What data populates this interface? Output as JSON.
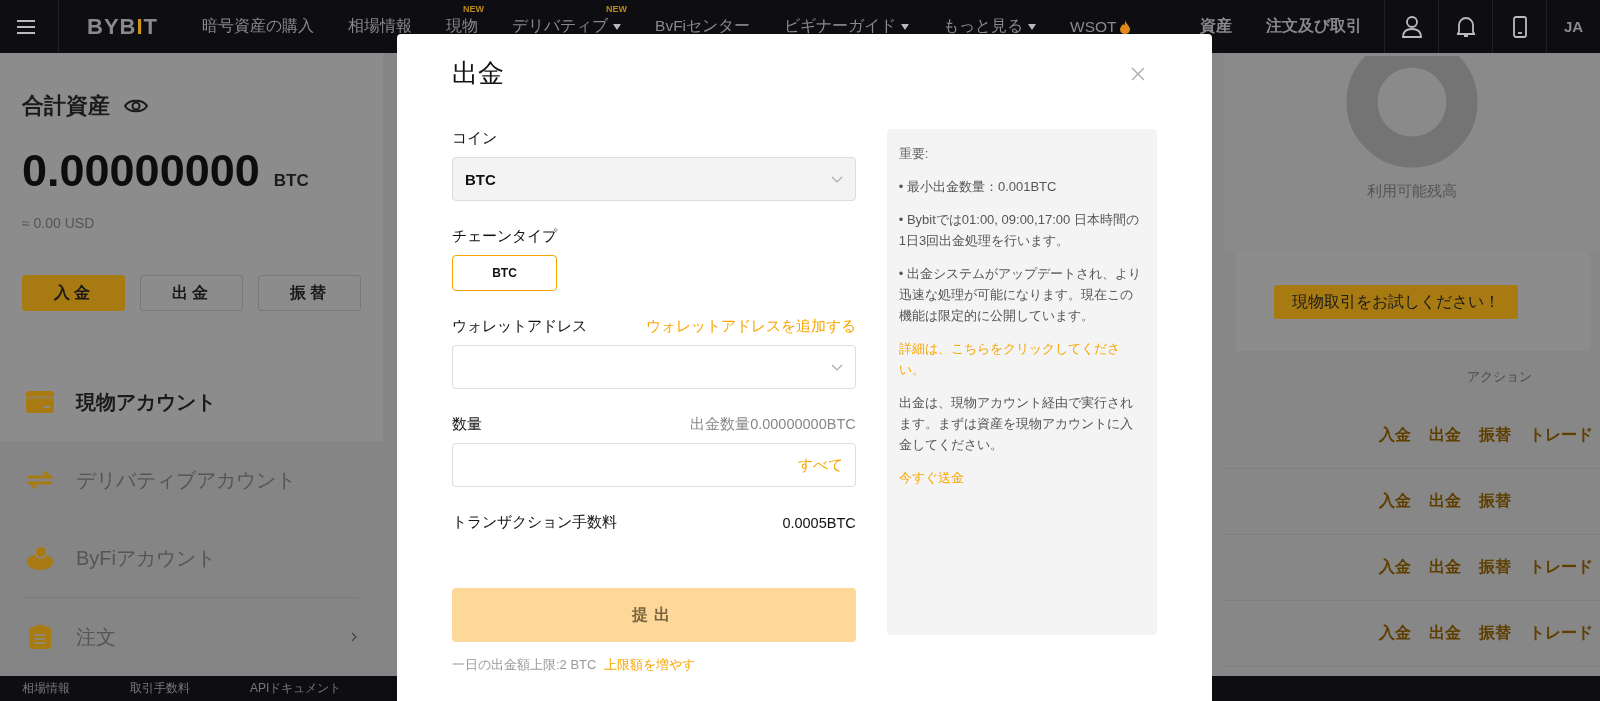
{
  "nav": {
    "brand": "BYBIT",
    "items": [
      {
        "kind": "plain",
        "label": "暗号資産の購入"
      },
      {
        "kind": "plain",
        "label": "相場情報"
      },
      {
        "kind": "plain",
        "label": "現物",
        "badge": "NEW"
      },
      {
        "kind": "dropdown",
        "label": "デリバティブ",
        "badge": "NEW"
      },
      {
        "kind": "plain",
        "label": "BvFiセンター"
      },
      {
        "kind": "dropdown",
        "label": "ビギナーガイド"
      },
      {
        "kind": "dropdown",
        "label": "もっと見る"
      },
      {
        "kind": "hot",
        "label": "WSOT"
      }
    ],
    "right": [
      "資産",
      "注文及び取引"
    ],
    "language": "JA"
  },
  "summary": {
    "title": "合計資産",
    "amount": "0.00000000",
    "unit": "BTC",
    "usd": "≈ 0.00 USD",
    "buttons": [
      {
        "label": "入金",
        "primary": true
      },
      {
        "label": "出金",
        "primary": false
      },
      {
        "label": "振替",
        "primary": false
      }
    ]
  },
  "accounts": [
    {
      "kind": "card",
      "label": "現物アカウント",
      "selected": true
    },
    {
      "kind": "swap",
      "label": "デリバティブアカウント",
      "selected": false
    },
    {
      "kind": "piggy",
      "label": "ByFiアカウント",
      "selected": false
    },
    {
      "kind": "orders",
      "label": "注文",
      "selected": false
    }
  ],
  "balance": {
    "label": "利用可能残高",
    "promo": "現物取引をお試しください！",
    "action_header": "アクション",
    "rows": [
      [
        "入金",
        "出金",
        "振替",
        "トレード"
      ],
      [
        "入金",
        "出金",
        "振替"
      ],
      [
        "入金",
        "出金",
        "振替",
        "トレード"
      ],
      [
        "入金",
        "出金",
        "振替",
        "トレード"
      ]
    ]
  },
  "footer": [
    "相場情報",
    "取引手数料",
    "APIドキュメント"
  ],
  "modal": {
    "title": "出金",
    "coin": {
      "label": "コイン",
      "value": "BTC"
    },
    "chain": {
      "label": "チェーンタイプ",
      "options": [
        {
          "label": "BTC",
          "selected": true
        }
      ]
    },
    "address": {
      "label": "ウォレットアドレス",
      "link": "ウォレットアドレスを追加する"
    },
    "amount": {
      "label": "数量",
      "hint": "出金数量0.00000000BTC",
      "all": "すべて"
    },
    "fee": {
      "label": "トランザクション手数料",
      "value": "0.0005BTC"
    },
    "submit": {
      "label": "提出",
      "disabled": true
    },
    "limit": {
      "text": "一日の出金額上限:2 BTC",
      "link": "上限額を増やす"
    },
    "notes": [
      {
        "kind": "heading",
        "text": "重要:"
      },
      {
        "kind": "text",
        "text": "• 最小出金数量：0.001BTC"
      },
      {
        "kind": "text",
        "text": "• Bybitでは01:00, 09:00,17:00 日本時間の1日3回出金処理を行います。"
      },
      {
        "kind": "text",
        "text": "• 出金システムがアップデートされ、より迅速な処理が可能になります。現在この機能は限定的に公開しています。"
      },
      {
        "kind": "link",
        "text": "詳細は、こちらをクリックしてください。"
      },
      {
        "kind": "text",
        "text": "出金は、現物アカウント経由で実行されます。まずは資産を現物アカウントに入金してください。"
      },
      {
        "kind": "link",
        "text": "今すぐ送金"
      }
    ]
  }
}
